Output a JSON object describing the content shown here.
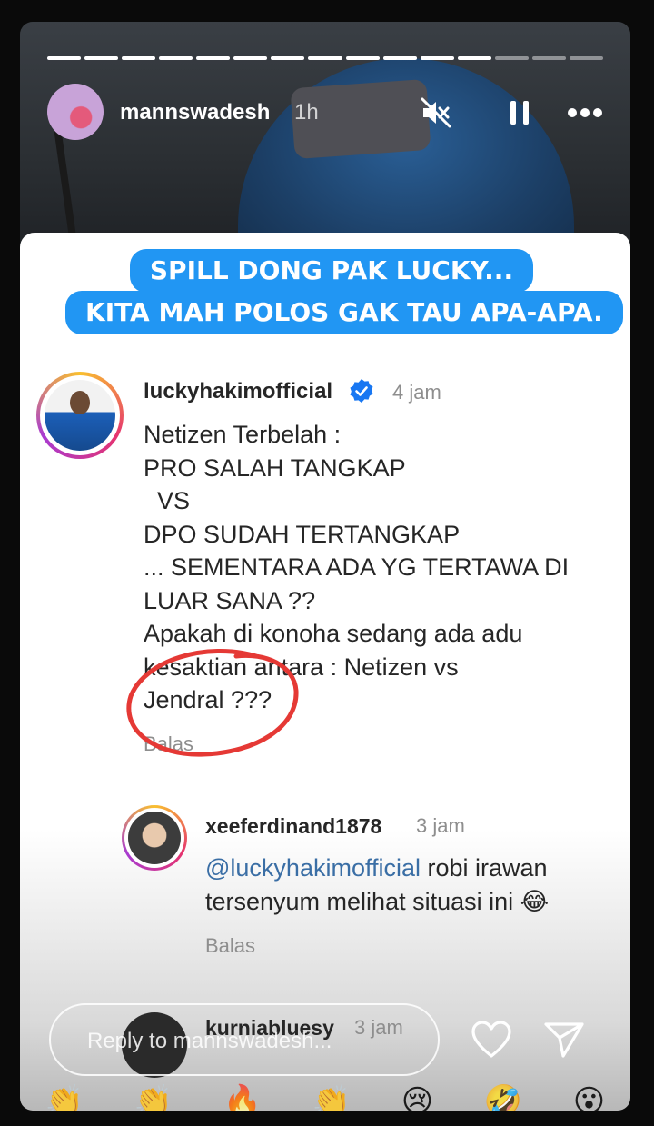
{
  "story": {
    "username": "mannswadesh",
    "time": "1h",
    "progress_segments": 15,
    "progress_done": 12
  },
  "icons": {
    "mute": "speaker-muted-icon",
    "pause": "pause-icon",
    "more": "more-icon",
    "like": "heart-icon",
    "send": "send-icon"
  },
  "banner": {
    "line1": "SPILL DONG PAK LUCKY...",
    "line2": "KITA MAH POLOS GAK TAU APA-APA."
  },
  "comments": [
    {
      "username": "luckyhakimofficial",
      "verified": true,
      "time": "4 jam",
      "text": "Netizen Terbelah :\nPRO SALAH TANGKAP\n  VS\nDPO SUDAH TERTANGKAP\n... SEMENTARA ADA YG TERTAWA DI\nLUAR SANA ??\nApakah di konoha sedang ada adu\nkesaktian antara : Netizen vs\nJendral ???",
      "reply": "Balas"
    },
    {
      "username": "xeeferdinand1878",
      "time": "3 jam",
      "mention": "@luckyhakimofficial",
      "text": " robi irawan\ntersenyum melihat situasi ini 😂",
      "reply": "Balas"
    },
    {
      "username": "kurniabluesy",
      "time": "3 jam"
    }
  ],
  "footer": {
    "reply_placeholder": "Reply to mannswadesh...",
    "emojis": [
      "👏",
      "👏",
      "🔥",
      "👏",
      "😢",
      "🤣",
      "😮"
    ]
  },
  "colors": {
    "banner": "#2196f3",
    "verified": "#1877f2",
    "annotation": "#e53935",
    "mention": "#3a6ea5"
  }
}
